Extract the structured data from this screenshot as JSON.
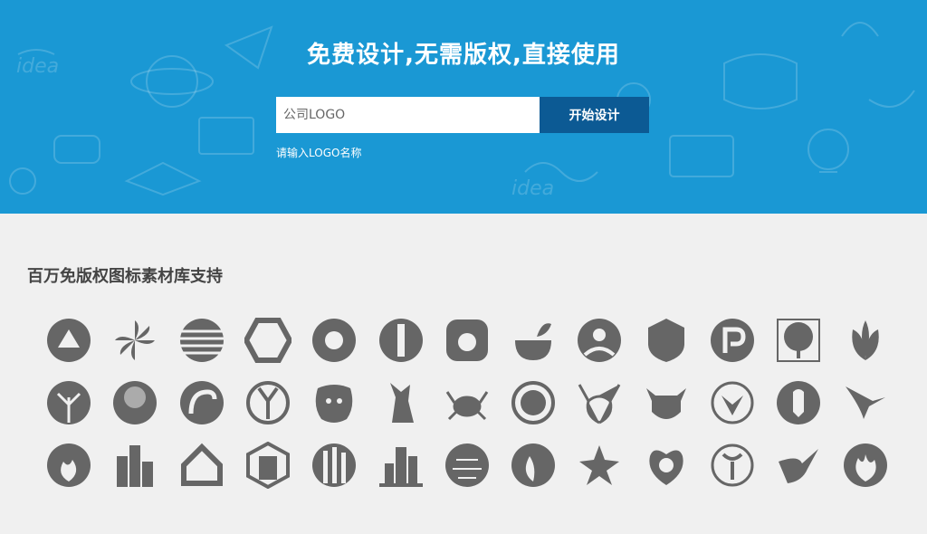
{
  "hero": {
    "title": "免费设计,无需版权,直接使用",
    "search_placeholder": "公司LOGO",
    "button_label": "开始设计",
    "hint": "请输入LOGO名称",
    "background_color": "#1a98d4",
    "button_color": "#0c5a94"
  },
  "section": {
    "title": "百万免版权图标素材库支持",
    "icon_color": "#666666"
  },
  "icons": [
    [
      "fox-icon",
      "pinwheel-icon",
      "striped-sphere-icon",
      "hexagon-icon",
      "aperture-icon",
      "fork-circle-icon",
      "bear-box-icon",
      "mortar-leaf-icon",
      "person-circle-icon",
      "lion-crest-icon",
      "letter-p-icon",
      "tree-square-icon",
      "leaves-icon"
    ],
    [
      "tree-circle-icon",
      "oak-circle-icon",
      "bird-circle-icon",
      "deer-circle-icon",
      "bear-face-icon",
      "fox-sitting-icon",
      "crab-icon",
      "lion-circle-icon",
      "deer-head-icon",
      "cow-head-icon",
      "geometric-deer-icon",
      "lobster-circle-icon",
      "eagle-icon"
    ],
    [
      "flame-circle-icon",
      "buildings-icon",
      "house-outline-icon",
      "hexagon-building-icon",
      "building-circle-icon",
      "city-skyline-icon",
      "face-mosaic-icon",
      "phoenix-circle-icon",
      "star-figure-icon",
      "heart-foot-icon",
      "lobster-outline-icon",
      "bird-flying-icon",
      "flame-swirl-icon"
    ]
  ]
}
